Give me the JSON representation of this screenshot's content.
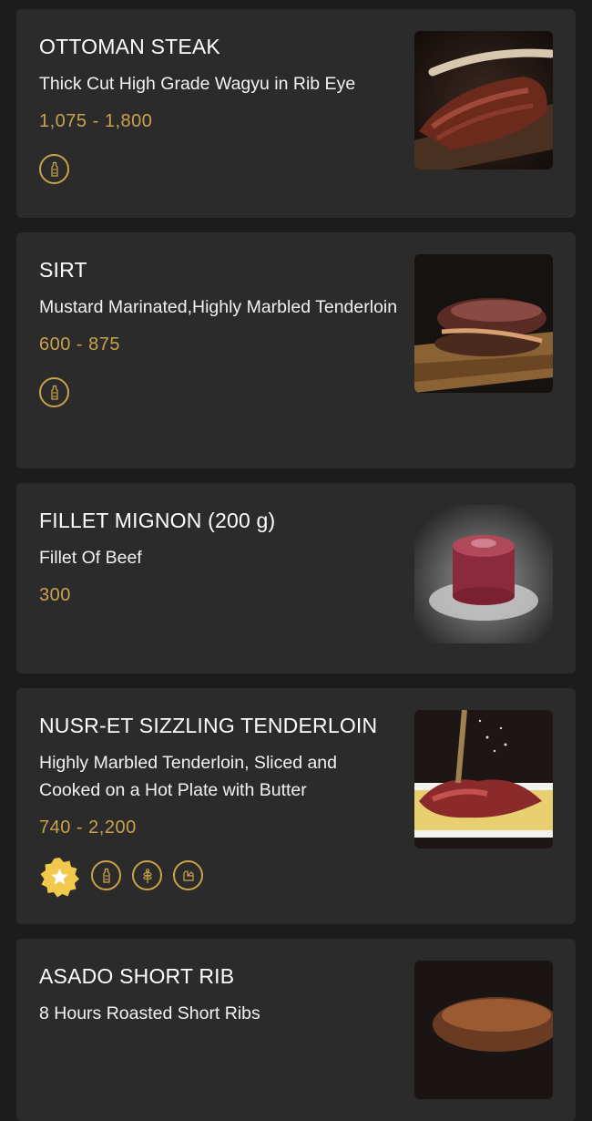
{
  "colors": {
    "background": "#1c1c1c",
    "card": "#2b2b2b",
    "price": "#c9a24a"
  },
  "items": [
    {
      "title": "OTTOMAN STEAK",
      "description": "Thick Cut High Grade Wagyu in Rib Eye",
      "price": "1,075 - 1,800",
      "badges": [
        "sauce-bottle-icon"
      ],
      "image": "steak-photo"
    },
    {
      "title": "SIRT",
      "description": "Mustard Marinated,Highly Marbled Tenderloin",
      "price": "600 - 875",
      "badges": [
        "sauce-bottle-icon"
      ],
      "image": "sirt-photo"
    },
    {
      "title": "FILLET MIGNON (200 g)",
      "description": "Fillet Of Beef",
      "price": "300",
      "badges": [],
      "image": "fillet-photo"
    },
    {
      "title": "NUSR-ET SIZZLING TENDERLOIN",
      "description": "Highly Marbled Tenderloin, Sliced and Cooked on a Hot Plate with Butter",
      "price": "740 - 2,200",
      "badges": [
        "star-badge-icon",
        "sauce-bottle-icon",
        "wheat-icon",
        "dairy-icon"
      ],
      "image": "tenderloin-photo"
    },
    {
      "title": "ASADO SHORT RIB",
      "description": "8 Hours Roasted Short Ribs",
      "price": "",
      "badges": [],
      "image": "short-rib-photo"
    }
  ]
}
